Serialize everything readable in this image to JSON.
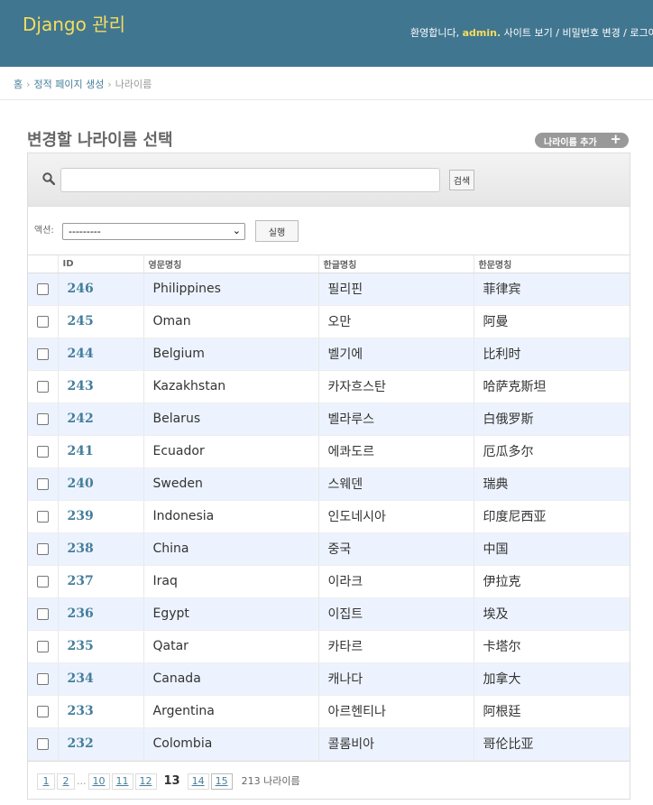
{
  "header": {
    "brand": "Django 관리",
    "welcome_prefix": "환영합니다,",
    "username": "admin.",
    "links": [
      "사이트 보기",
      "비밀번호 변경",
      "로그아웃"
    ]
  },
  "breadcrumbs": [
    "홈",
    "정적 페이지 생성",
    "나라이름"
  ],
  "page_title": "변경할 나라이름 선택",
  "add_button": "나라이름 추가",
  "search": {
    "value": "",
    "button": "검색"
  },
  "actions": {
    "label": "액션:",
    "selected": "---------",
    "run": "실행"
  },
  "columns": [
    "ID",
    "영문명칭",
    "한글명칭",
    "한문명칭"
  ],
  "rows": [
    {
      "id": "246",
      "en": "Philippines",
      "ko": "필리핀",
      "zh": "菲律宾"
    },
    {
      "id": "245",
      "en": "Oman",
      "ko": "오만",
      "zh": "阿曼"
    },
    {
      "id": "244",
      "en": "Belgium",
      "ko": "벨기에",
      "zh": "比利时"
    },
    {
      "id": "243",
      "en": "Kazakhstan",
      "ko": "카자흐스탄",
      "zh": "哈萨克斯坦"
    },
    {
      "id": "242",
      "en": "Belarus",
      "ko": "벨라루스",
      "zh": "白俄罗斯"
    },
    {
      "id": "241",
      "en": "Ecuador",
      "ko": "에콰도르",
      "zh": "厄瓜多尔"
    },
    {
      "id": "240",
      "en": "Sweden",
      "ko": "스웨덴",
      "zh": "瑞典"
    },
    {
      "id": "239",
      "en": "Indonesia",
      "ko": "인도네시아",
      "zh": "印度尼西亚"
    },
    {
      "id": "238",
      "en": "China",
      "ko": "중국",
      "zh": "中国"
    },
    {
      "id": "237",
      "en": "Iraq",
      "ko": "이라크",
      "zh": "伊拉克"
    },
    {
      "id": "236",
      "en": "Egypt",
      "ko": "이집트",
      "zh": "埃及"
    },
    {
      "id": "235",
      "en": "Qatar",
      "ko": "카타르",
      "zh": "卡塔尔"
    },
    {
      "id": "234",
      "en": "Canada",
      "ko": "캐나다",
      "zh": "加拿大"
    },
    {
      "id": "233",
      "en": "Argentina",
      "ko": "아르헨티나",
      "zh": "阿根廷"
    },
    {
      "id": "232",
      "en": "Colombia",
      "ko": "콜롬비아",
      "zh": "哥伦比亚"
    }
  ],
  "pagination": {
    "first_pages": [
      "1",
      "2"
    ],
    "ellipsis": "...",
    "middle_pages": [
      "10",
      "11",
      "12"
    ],
    "current": "13",
    "after_pages": [
      "14"
    ],
    "last_page": "15",
    "count_text": "213 나라이름"
  }
}
